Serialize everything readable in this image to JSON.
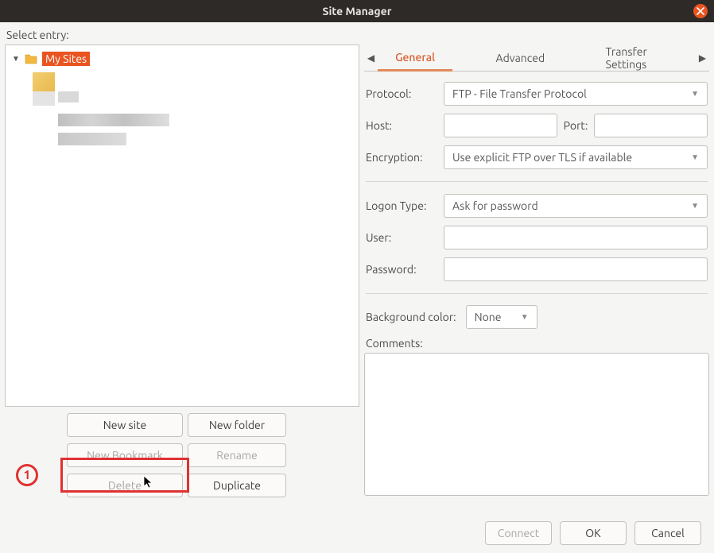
{
  "window": {
    "title": "Site Manager"
  },
  "leftPanel": {
    "selectLabel": "Select entry:",
    "tree": {
      "root": "My Sites"
    },
    "buttons": {
      "newSite": "New site",
      "newFolder": "New folder",
      "newBookmark": "New Bookmark",
      "rename": "Rename",
      "delete": "Delete",
      "duplicate": "Duplicate"
    }
  },
  "annotation": {
    "step1": "1"
  },
  "tabs": {
    "general": "General",
    "advanced": "Advanced",
    "transfer": "Transfer Settings"
  },
  "form": {
    "protocolLabel": "Protocol:",
    "protocolValue": "FTP - File Transfer Protocol",
    "hostLabel": "Host:",
    "hostValue": "",
    "portLabel": "Port:",
    "portValue": "",
    "encryptionLabel": "Encryption:",
    "encryptionValue": "Use explicit FTP over TLS if available",
    "logonTypeLabel": "Logon Type:",
    "logonTypeValue": "Ask for password",
    "userLabel": "User:",
    "userValue": "",
    "passwordLabel": "Password:",
    "passwordValue": "",
    "bgColorLabel": "Background color:",
    "bgColorValue": "None",
    "commentsLabel": "Comments:",
    "commentsValue": ""
  },
  "footer": {
    "connect": "Connect",
    "ok": "OK",
    "cancel": "Cancel"
  }
}
